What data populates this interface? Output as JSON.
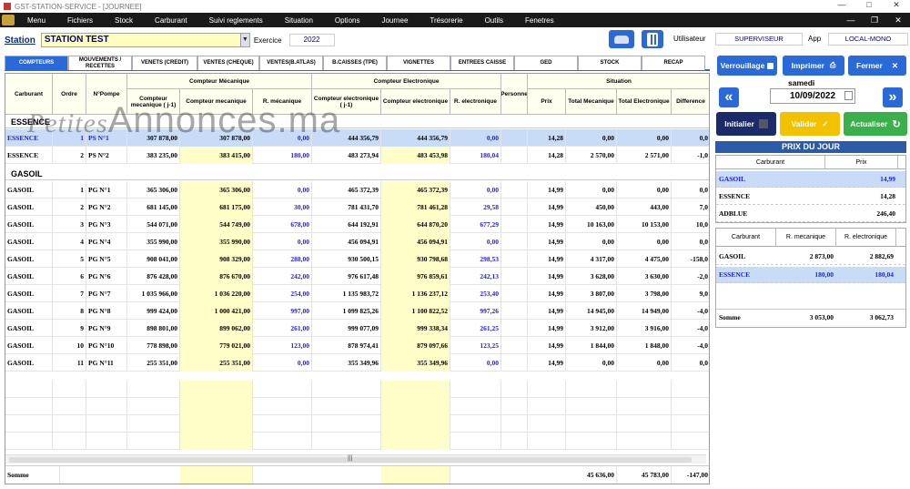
{
  "window": {
    "title": "GST-STATION-SERVICE - [JOURNEE]"
  },
  "menu": [
    "Menu",
    "Fichiers",
    "Stock",
    "Carburant",
    "Suivi reglements",
    "Situation",
    "Options",
    "Journee",
    "Trésorerie",
    "Outils",
    "Fenetres"
  ],
  "station": {
    "label": "Station",
    "value": "STATION TEST",
    "exercice_label": "Exercice",
    "exercice": "2022"
  },
  "user": {
    "label": "Utilisateur",
    "value": "SUPERVISEUR",
    "app_label": "App",
    "app_value": "LOCAL-MONO"
  },
  "tabs": [
    "COMPTEURS",
    "MOUVEMENTS / RECETTES",
    "VENETS (CREDIT)",
    "VENTES (CHEQUE)",
    "VENTES(B.ATLAS)",
    "B.CAISSES (TPE)",
    "VIGNETTES",
    "ENTREES CAISSE",
    "GED",
    "STOCK",
    "RECAP"
  ],
  "columns": {
    "carburant": "Carburant",
    "ordre": "Ordre",
    "pompe": "N°Pompe",
    "grp_meca": "Compteur Mécanique",
    "meca_j1": "Compteur mecanique ( j-1)",
    "meca": "Compteur mecanique",
    "r_meca": "R. mécanique",
    "grp_elec": "Compteur Electronique",
    "elec_j1": "Compteur electronique ( j-1)",
    "elec": "Compteur electronique",
    "r_elec": "R. electronique",
    "personne": "Personne",
    "grp_sit": "Situation",
    "prix": "Prix",
    "tot_meca": "Total Mecanique",
    "tot_elec": "Total Electronique",
    "diff": "Difference"
  },
  "groups": [
    {
      "name": "ESSENCE",
      "rows": [
        {
          "c": "ESSENCE",
          "o": "1",
          "p": "PS N°1",
          "mj": "307 878,00",
          "m": "307 878,00",
          "rm": "0,00",
          "ej": "444 356,79",
          "e": "444 356,79",
          "re": "0,00",
          "prix": "14,28",
          "tm": "0,00",
          "te": "0,00",
          "d": "0,0",
          "sel": true
        },
        {
          "c": "ESSENCE",
          "o": "2",
          "p": "PS N°2",
          "mj": "383 235,00",
          "m": "383 415,00",
          "rm": "180,00",
          "ej": "483 273,94",
          "e": "483 453,98",
          "re": "180,04",
          "prix": "14,28",
          "tm": "2 570,00",
          "te": "2 571,00",
          "d": "-1,0"
        }
      ]
    },
    {
      "name": "GASOIL",
      "rows": [
        {
          "c": "GASOIL",
          "o": "1",
          "p": "PG N°1",
          "mj": "365 306,00",
          "m": "365 306,00",
          "rm": "0,00",
          "ej": "465 372,39",
          "e": "465 372,39",
          "re": "0,00",
          "prix": "14,99",
          "tm": "0,00",
          "te": "0,00",
          "d": "0,0"
        },
        {
          "c": "GASOIL",
          "o": "2",
          "p": "PG N°2",
          "mj": "681 145,00",
          "m": "681 175,00",
          "rm": "30,00",
          "ej": "781 431,70",
          "e": "781 461,28",
          "re": "29,58",
          "prix": "14,99",
          "tm": "450,00",
          "te": "443,00",
          "d": "7,0"
        },
        {
          "c": "GASOIL",
          "o": "3",
          "p": "PG N°3",
          "mj": "544 071,00",
          "m": "544 749,00",
          "rm": "678,00",
          "ej": "644 192,91",
          "e": "644 870,20",
          "re": "677,29",
          "prix": "14,99",
          "tm": "10 163,00",
          "te": "10 153,00",
          "d": "10,0"
        },
        {
          "c": "GASOIL",
          "o": "4",
          "p": "PG N°4",
          "mj": "355 990,00",
          "m": "355 990,00",
          "rm": "0,00",
          "ej": "456 094,91",
          "e": "456 094,91",
          "re": "0,00",
          "prix": "14,99",
          "tm": "0,00",
          "te": "0,00",
          "d": "0,0"
        },
        {
          "c": "GASOIL",
          "o": "5",
          "p": "PG N°5",
          "mj": "908 041,00",
          "m": "908 329,00",
          "rm": "288,00",
          "ej": "930 500,15",
          "e": "930 798,68",
          "re": "298,53",
          "prix": "14,99",
          "tm": "4 317,00",
          "te": "4 475,00",
          "d": "-158,0"
        },
        {
          "c": "GASOIL",
          "o": "6",
          "p": "PG N°6",
          "mj": "876 428,00",
          "m": "876 670,00",
          "rm": "242,00",
          "ej": "976 617,48",
          "e": "976 859,61",
          "re": "242,13",
          "prix": "14,99",
          "tm": "3 628,00",
          "te": "3 630,00",
          "d": "-2,0"
        },
        {
          "c": "GASOIL",
          "o": "7",
          "p": "PG N°7",
          "mj": "1 035 966,00",
          "m": "1 036 220,00",
          "rm": "254,00",
          "ej": "1 135 983,72",
          "e": "1 136 237,12",
          "re": "253,40",
          "prix": "14,99",
          "tm": "3 807,00",
          "te": "3 798,00",
          "d": "9,0"
        },
        {
          "c": "GASOIL",
          "o": "8",
          "p": "PG N°8",
          "mj": "999 424,00",
          "m": "1 000 421,00",
          "rm": "997,00",
          "ej": "1 099 825,26",
          "e": "1 100 822,52",
          "re": "997,26",
          "prix": "14,99",
          "tm": "14 945,00",
          "te": "14 949,00",
          "d": "-4,0"
        },
        {
          "c": "GASOIL",
          "o": "9",
          "p": "PG N°9",
          "mj": "898 801,00",
          "m": "899 062,00",
          "rm": "261,00",
          "ej": "999 077,09",
          "e": "999 338,34",
          "re": "261,25",
          "prix": "14,99",
          "tm": "3 912,00",
          "te": "3 916,00",
          "d": "-4,0"
        },
        {
          "c": "GASOIL",
          "o": "10",
          "p": "PG N°10",
          "mj": "778 898,00",
          "m": "779 021,00",
          "rm": "123,00",
          "ej": "878 974,41",
          "e": "879 097,66",
          "re": "123,25",
          "prix": "14,99",
          "tm": "1 844,00",
          "te": "1 848,00",
          "d": "-4,0"
        },
        {
          "c": "GASOIL",
          "o": "11",
          "p": "PG N°11",
          "mj": "255 351,00",
          "m": "255 351,00",
          "rm": "0,00",
          "ej": "355 349,96",
          "e": "355 349,96",
          "re": "0,00",
          "prix": "14,99",
          "tm": "0,00",
          "te": "0,00",
          "d": "0,0"
        }
      ]
    }
  ],
  "somme": {
    "label": "Somme",
    "tm": "45 636,00",
    "te": "45 783,00",
    "d": "-147,00"
  },
  "watermark": {
    "a": "Petites",
    "b": "Annonces.ma"
  },
  "actions": {
    "verrouillage": "Verrouillage",
    "imprimer": "Imprimer",
    "fermer": "Fermer",
    "initialier": "Initialier",
    "valider": "Valider",
    "actualiser": "Actualiser"
  },
  "date": {
    "day": "samedi",
    "value": "10/09/2022"
  },
  "prix_du_jour": {
    "title": "PRIX DU JOUR",
    "h1": "Carburant",
    "h2": "Prix",
    "rows": [
      {
        "c": "GASOIL",
        "p": "14,99",
        "sel": true
      },
      {
        "c": "ESSENCE",
        "p": "14,28"
      },
      {
        "c": "ADBLUE",
        "p": "246,40"
      }
    ]
  },
  "recap": {
    "h1": "Carburant",
    "h2": "R. mecanique",
    "h3": "R. electronique",
    "rows": [
      {
        "c": "GASOIL",
        "m": "2 873,00",
        "e": "2 882,69"
      },
      {
        "c": "ESSENCE",
        "m": "180,00",
        "e": "180,04",
        "sel": true
      }
    ],
    "somme_label": "Somme",
    "somme_m": "3 053,00",
    "somme_e": "3 062,73"
  },
  "colors": {
    "accent": "#2a6ad8",
    "valider": "#f2c200",
    "actualiser": "#3ab04a",
    "dark_btn": "#1a2a6a"
  }
}
